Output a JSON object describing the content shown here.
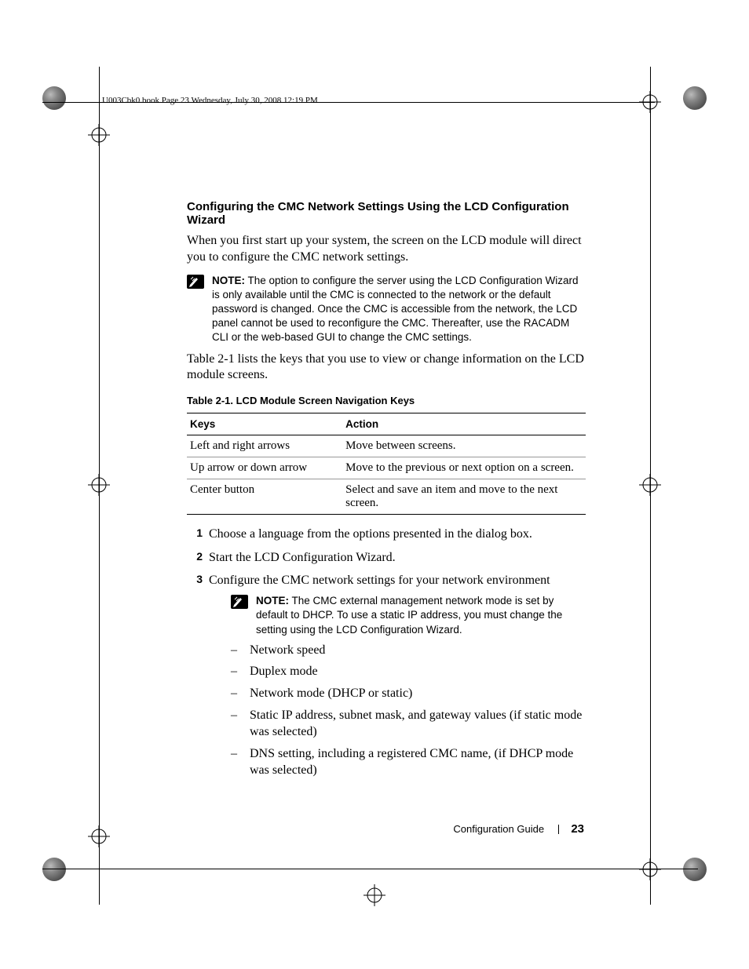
{
  "header_line": "U003Cbk0.book  Page 23  Wednesday, July 30, 2008  12:19 PM",
  "section_heading": "Configuring the CMC Network Settings Using the LCD Configuration Wizard",
  "intro_para": "When you first start up your system, the screen on the LCD module will direct you to configure the CMC network settings.",
  "note1_label": "NOTE:",
  "note1_text": " The option to configure the server using the LCD Configuration Wizard is only available until the CMC is connected to the network or the default password is changed. Once the CMC is accessible from the network, the LCD panel cannot be used to reconfigure the CMC. Thereafter, use the RACADM CLI or the web-based GUI to change the CMC settings.",
  "para_after_note": "Table 2-1 lists the keys that you use to view or change information on the LCD module screens.",
  "table_caption": "Table 2-1.    LCD Module Screen Navigation Keys",
  "table": {
    "head": {
      "keys": "Keys",
      "action": "Action"
    },
    "rows": [
      {
        "keys": "Left and right arrows",
        "action": "Move between screens."
      },
      {
        "keys": "Up arrow or down arrow",
        "action": "Move to the previous or next option on a screen."
      },
      {
        "keys": "Center button",
        "action": "Select and save an item and move to the next screen."
      }
    ]
  },
  "steps": [
    "Choose a language from the options presented in the dialog box.",
    "Start the LCD Configuration Wizard.",
    "Configure the CMC network settings for your network environment"
  ],
  "note2_label": "NOTE:",
  "note2_text": " The CMC external management network mode is set by default to DHCP. To use a static IP address, you must change the setting using the LCD Configuration Wizard.",
  "bullets": [
    "Network speed",
    "Duplex mode",
    "Network mode (DHCP or static)",
    "Static IP address, subnet mask, and gateway values (if static mode was selected)",
    "DNS setting, including a registered CMC name, (if DHCP mode was selected)"
  ],
  "footer": {
    "title": "Configuration Guide",
    "page": "23"
  }
}
